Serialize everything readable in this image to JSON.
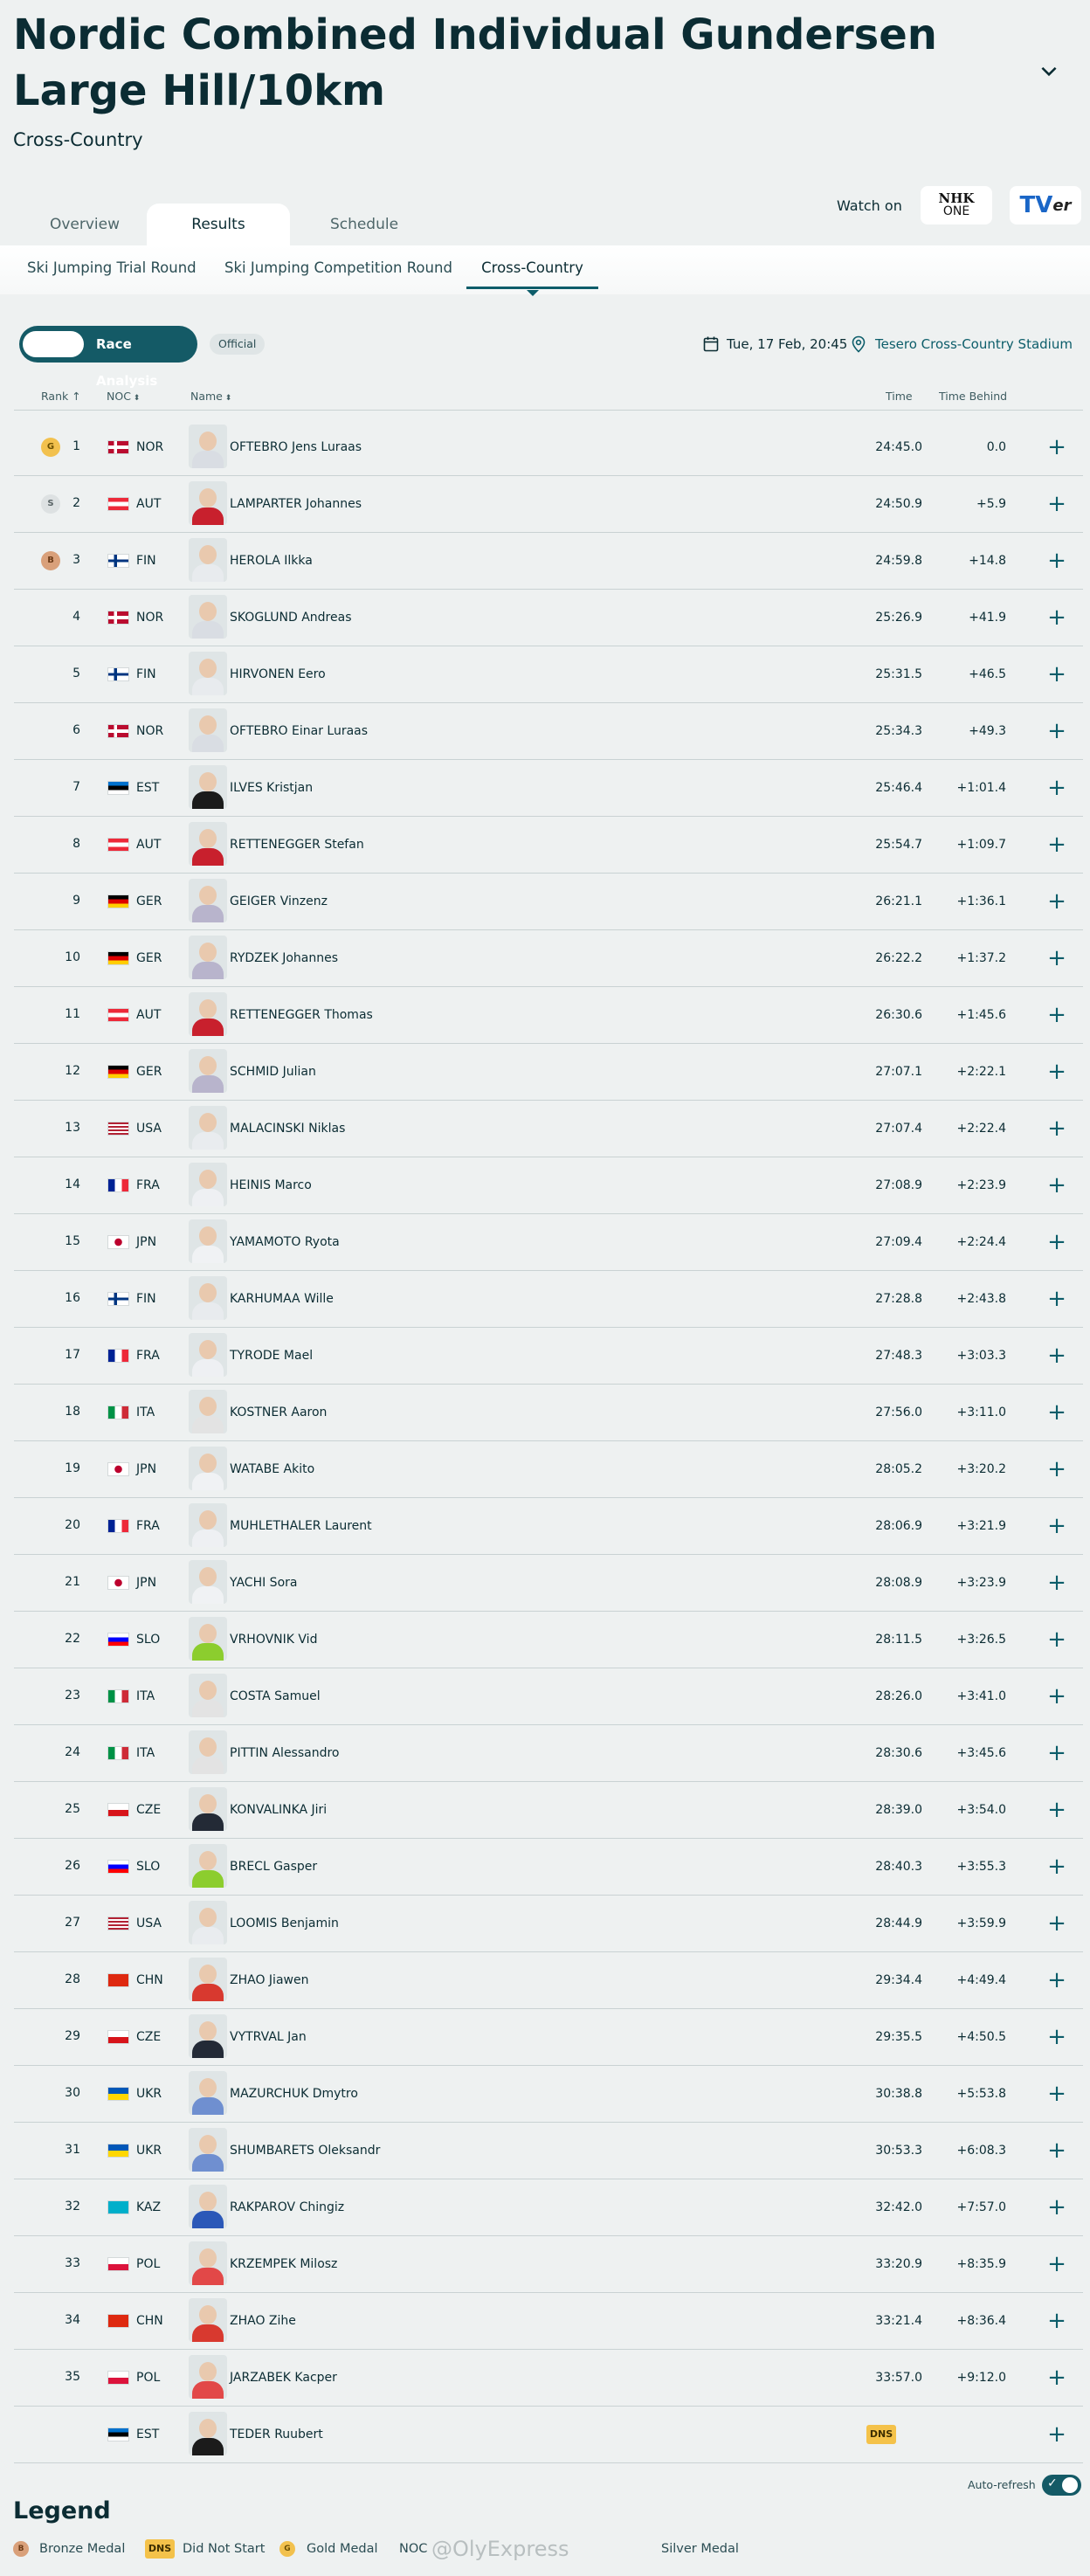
{
  "header": {
    "title": "Nordic Combined Individual Gundersen Large Hill/10km",
    "subtitle": "Cross-Country"
  },
  "tabs": [
    {
      "label": "Overview"
    },
    {
      "label": "Results",
      "active": true
    },
    {
      "label": "Schedule"
    }
  ],
  "watch": {
    "label": "Watch on",
    "nhk_line1": "NHK",
    "nhk_line2": "ONE",
    "tver_main": "TV",
    "tver_small": "er"
  },
  "subtabs": [
    {
      "label": "Ski Jumping Trial Round"
    },
    {
      "label": "Ski Jumping Competition Round"
    },
    {
      "label": "Cross-Country",
      "active": true
    }
  ],
  "controls": {
    "race_analysis": "Race Analysis",
    "official": "Official",
    "date": "Tue, 17 Feb, 20:45",
    "venue": "Tesero Cross-Country Stadium"
  },
  "table": {
    "headers": {
      "rank": "Rank",
      "noc": "NOC",
      "name": "Name",
      "time": "Time",
      "time_behind": "Time Behind"
    },
    "rows": [
      {
        "rank": "1",
        "medal": "G",
        "noc": "NOR",
        "name": "OFTEBRO Jens Luraas",
        "time": "24:45.0",
        "behind": "0.0"
      },
      {
        "rank": "2",
        "medal": "S",
        "noc": "AUT",
        "name": "LAMPARTER Johannes",
        "time": "24:50.9",
        "behind": "+5.9"
      },
      {
        "rank": "3",
        "medal": "B",
        "noc": "FIN",
        "name": "HEROLA Ilkka",
        "time": "24:59.8",
        "behind": "+14.8"
      },
      {
        "rank": "4",
        "medal": "",
        "noc": "NOR",
        "name": "SKOGLUND Andreas",
        "time": "25:26.9",
        "behind": "+41.9"
      },
      {
        "rank": "5",
        "medal": "",
        "noc": "FIN",
        "name": "HIRVONEN Eero",
        "time": "25:31.5",
        "behind": "+46.5"
      },
      {
        "rank": "6",
        "medal": "",
        "noc": "NOR",
        "name": "OFTEBRO Einar Luraas",
        "time": "25:34.3",
        "behind": "+49.3"
      },
      {
        "rank": "7",
        "medal": "",
        "noc": "EST",
        "name": "ILVES Kristjan",
        "time": "25:46.4",
        "behind": "+1:01.4"
      },
      {
        "rank": "8",
        "medal": "",
        "noc": "AUT",
        "name": "RETTENEGGER Stefan",
        "time": "25:54.7",
        "behind": "+1:09.7"
      },
      {
        "rank": "9",
        "medal": "",
        "noc": "GER",
        "name": "GEIGER Vinzenz",
        "time": "26:21.1",
        "behind": "+1:36.1"
      },
      {
        "rank": "10",
        "medal": "",
        "noc": "GER",
        "name": "RYDZEK Johannes",
        "time": "26:22.2",
        "behind": "+1:37.2"
      },
      {
        "rank": "11",
        "medal": "",
        "noc": "AUT",
        "name": "RETTENEGGER Thomas",
        "time": "26:30.6",
        "behind": "+1:45.6"
      },
      {
        "rank": "12",
        "medal": "",
        "noc": "GER",
        "name": "SCHMID Julian",
        "time": "27:07.1",
        "behind": "+2:22.1"
      },
      {
        "rank": "13",
        "medal": "",
        "noc": "USA",
        "name": "MALACINSKI Niklas",
        "time": "27:07.4",
        "behind": "+2:22.4"
      },
      {
        "rank": "14",
        "medal": "",
        "noc": "FRA",
        "name": "HEINIS Marco",
        "time": "27:08.9",
        "behind": "+2:23.9"
      },
      {
        "rank": "15",
        "medal": "",
        "noc": "JPN",
        "name": "YAMAMOTO Ryota",
        "time": "27:09.4",
        "behind": "+2:24.4"
      },
      {
        "rank": "16",
        "medal": "",
        "noc": "FIN",
        "name": "KARHUMAA Wille",
        "time": "27:28.8",
        "behind": "+2:43.8"
      },
      {
        "rank": "17",
        "medal": "",
        "noc": "FRA",
        "name": "TYRODE Mael",
        "time": "27:48.3",
        "behind": "+3:03.3"
      },
      {
        "rank": "18",
        "medal": "",
        "noc": "ITA",
        "name": "KOSTNER Aaron",
        "time": "27:56.0",
        "behind": "+3:11.0"
      },
      {
        "rank": "19",
        "medal": "",
        "noc": "JPN",
        "name": "WATABE Akito",
        "time": "28:05.2",
        "behind": "+3:20.2"
      },
      {
        "rank": "20",
        "medal": "",
        "noc": "FRA",
        "name": "MUHLETHALER Laurent",
        "time": "28:06.9",
        "behind": "+3:21.9"
      },
      {
        "rank": "21",
        "medal": "",
        "noc": "JPN",
        "name": "YACHI Sora",
        "time": "28:08.9",
        "behind": "+3:23.9"
      },
      {
        "rank": "22",
        "medal": "",
        "noc": "SLO",
        "name": "VRHOVNIK Vid",
        "time": "28:11.5",
        "behind": "+3:26.5"
      },
      {
        "rank": "23",
        "medal": "",
        "noc": "ITA",
        "name": "COSTA Samuel",
        "time": "28:26.0",
        "behind": "+3:41.0"
      },
      {
        "rank": "24",
        "medal": "",
        "noc": "ITA",
        "name": "PITTIN Alessandro",
        "time": "28:30.6",
        "behind": "+3:45.6"
      },
      {
        "rank": "25",
        "medal": "",
        "noc": "CZE",
        "name": "KONVALINKA Jiri",
        "time": "28:39.0",
        "behind": "+3:54.0"
      },
      {
        "rank": "26",
        "medal": "",
        "noc": "SLO",
        "name": "BRECL Gasper",
        "time": "28:40.3",
        "behind": "+3:55.3"
      },
      {
        "rank": "27",
        "medal": "",
        "noc": "USA",
        "name": "LOOMIS Benjamin",
        "time": "28:44.9",
        "behind": "+3:59.9"
      },
      {
        "rank": "28",
        "medal": "",
        "noc": "CHN",
        "name": "ZHAO Jiawen",
        "time": "29:34.4",
        "behind": "+4:49.4"
      },
      {
        "rank": "29",
        "medal": "",
        "noc": "CZE",
        "name": "VYTRVAL Jan",
        "time": "29:35.5",
        "behind": "+4:50.5"
      },
      {
        "rank": "30",
        "medal": "",
        "noc": "UKR",
        "name": "MAZURCHUK Dmytro",
        "time": "30:38.8",
        "behind": "+5:53.8"
      },
      {
        "rank": "31",
        "medal": "",
        "noc": "UKR",
        "name": "SHUMBARETS Oleksandr",
        "time": "30:53.3",
        "behind": "+6:08.3"
      },
      {
        "rank": "32",
        "medal": "",
        "noc": "KAZ",
        "name": "RAKPAROV Chingiz",
        "time": "32:42.0",
        "behind": "+7:57.0"
      },
      {
        "rank": "33",
        "medal": "",
        "noc": "POL",
        "name": "KRZEMPEK Milosz",
        "time": "33:20.9",
        "behind": "+8:35.9"
      },
      {
        "rank": "34",
        "medal": "",
        "noc": "CHN",
        "name": "ZHAO Zihe",
        "time": "33:21.4",
        "behind": "+8:36.4"
      },
      {
        "rank": "35",
        "medal": "",
        "noc": "POL",
        "name": "JARZABEK Kacper",
        "time": "33:57.0",
        "behind": "+9:12.0"
      },
      {
        "rank": "",
        "medal": "",
        "noc": "EST",
        "name": "TEDER Ruubert",
        "time": "",
        "behind": "",
        "status": "DNS"
      }
    ]
  },
  "footer": {
    "auto_refresh": "Auto-refresh",
    "legend_title": "Legend",
    "legend": {
      "bronze_badge": "B",
      "bronze": "Bronze Medal",
      "dns_badge": "DNS",
      "dns": "Did Not Start",
      "gold_badge": "G",
      "gold": "Gold Medal",
      "noc": "NOC",
      "silver": "Silver Medal"
    },
    "watermark": "@OlyExpress"
  },
  "colors": {
    "accent": "#0c5d6a",
    "dark": "#0b2c33",
    "gold": "#f2c14e",
    "silver": "#dde1e2",
    "bronze": "#d9a07a",
    "dns": "#f4c24a"
  }
}
